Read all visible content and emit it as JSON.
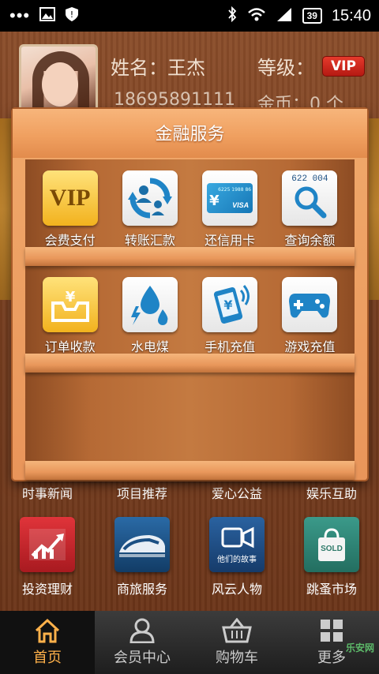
{
  "status_bar": {
    "time": "15:40",
    "battery": "39"
  },
  "profile": {
    "name": "姓名：王杰",
    "level_label": "等级：",
    "level_badge": "VIP",
    "phone": "18695891111",
    "coins": "金币：0 个"
  },
  "dialog": {
    "title": "金融服务",
    "row1": [
      {
        "label": "会费支付",
        "icon": "vip-icon",
        "icon_text": "VIP"
      },
      {
        "label": "转账汇款",
        "icon": "transfer-icon"
      },
      {
        "label": "还信用卡",
        "icon": "credit-card-icon",
        "card_number": "6225 1988 86",
        "card_brand": "VISA"
      },
      {
        "label": "查询余额",
        "icon": "search-balance-icon",
        "card_number": "622 004"
      }
    ],
    "row2": [
      {
        "label": "订单收款",
        "icon": "order-receipt-icon"
      },
      {
        "label": "水电煤",
        "icon": "utilities-icon"
      },
      {
        "label": "手机充值",
        "icon": "phone-recharge-icon"
      },
      {
        "label": "游戏充值",
        "icon": "gamepad-icon"
      }
    ]
  },
  "categories": [
    "时事新闻",
    "项目推荐",
    "爱心公益",
    "娱乐互助"
  ],
  "bottom_grid": [
    {
      "label": "投资理财",
      "icon": "investment-chart-icon",
      "color": "#c4262c"
    },
    {
      "label": "商旅服务",
      "icon": "train-icon",
      "color": "#1e5a8e"
    },
    {
      "label": "风云人物",
      "icon": "video-icon",
      "color": "#1d4f86",
      "caption": "他们的故事"
    },
    {
      "label": "跳蚤市场",
      "icon": "shopping-bag-icon",
      "color": "#2f8a7a",
      "caption": "SOLD"
    }
  ],
  "nav": [
    {
      "label": "首页",
      "icon": "home-icon",
      "active": true
    },
    {
      "label": "会员中心",
      "icon": "user-icon",
      "active": false
    },
    {
      "label": "购物车",
      "icon": "cart-icon",
      "active": false
    },
    {
      "label": "更多",
      "icon": "grid-icon",
      "active": false
    }
  ],
  "watermark": "乐安网"
}
